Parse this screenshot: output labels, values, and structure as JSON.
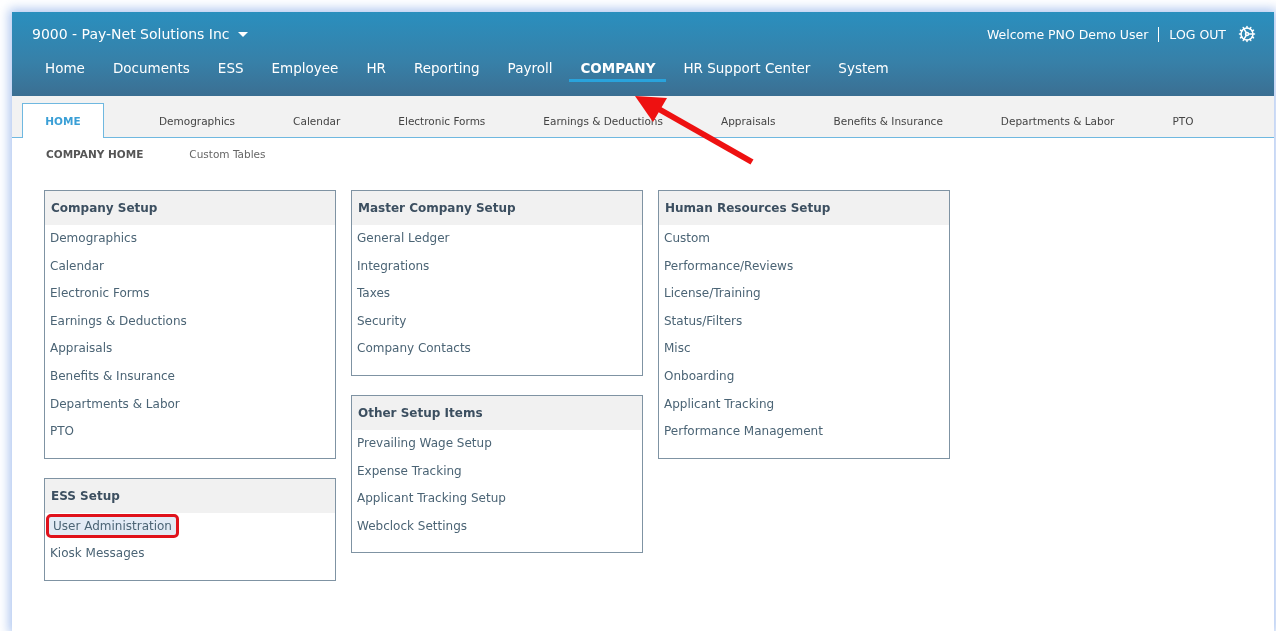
{
  "header": {
    "company": "9000 - Pay-Net Solutions Inc",
    "welcome": "Welcome PNO Demo User",
    "logout": "LOG OUT"
  },
  "nav": [
    {
      "label": "Home",
      "selected": false
    },
    {
      "label": "Documents",
      "selected": false
    },
    {
      "label": "ESS",
      "selected": false
    },
    {
      "label": "Employee",
      "selected": false
    },
    {
      "label": "HR",
      "selected": false
    },
    {
      "label": "Reporting",
      "selected": false
    },
    {
      "label": "Payroll",
      "selected": false
    },
    {
      "label": "COMPANY",
      "selected": true
    },
    {
      "label": "HR Support Center",
      "selected": false
    },
    {
      "label": "System",
      "selected": false
    }
  ],
  "tabs": [
    {
      "label": "HOME",
      "selected": true
    },
    {
      "label": "Demographics",
      "selected": false
    },
    {
      "label": "Calendar",
      "selected": false
    },
    {
      "label": "Electronic Forms",
      "selected": false
    },
    {
      "label": "Earnings & Deductions",
      "selected": false
    },
    {
      "label": "Appraisals",
      "selected": false
    },
    {
      "label": "Benefits & Insurance",
      "selected": false
    },
    {
      "label": "Departments & Labor",
      "selected": false
    },
    {
      "label": "PTO",
      "selected": false
    }
  ],
  "subnav": [
    {
      "label": "COMPANY HOME",
      "selected": true
    },
    {
      "label": "Custom Tables",
      "selected": false
    }
  ],
  "columns": [
    [
      {
        "title": "Company Setup",
        "items": [
          {
            "label": "Demographics",
            "highlighted": false
          },
          {
            "label": "Calendar",
            "highlighted": false
          },
          {
            "label": "Electronic Forms",
            "highlighted": false
          },
          {
            "label": "Earnings & Deductions",
            "highlighted": false
          },
          {
            "label": "Appraisals",
            "highlighted": false
          },
          {
            "label": "Benefits & Insurance",
            "highlighted": false
          },
          {
            "label": "Departments & Labor",
            "highlighted": false
          },
          {
            "label": "PTO",
            "highlighted": false
          }
        ]
      },
      {
        "title": "ESS Setup",
        "items": [
          {
            "label": "User Administration",
            "highlighted": true
          },
          {
            "label": "Kiosk Messages",
            "highlighted": false
          }
        ]
      }
    ],
    [
      {
        "title": "Master Company Setup",
        "items": [
          {
            "label": "General Ledger",
            "highlighted": false
          },
          {
            "label": "Integrations",
            "highlighted": false
          },
          {
            "label": "Taxes",
            "highlighted": false
          },
          {
            "label": "Security",
            "highlighted": false
          },
          {
            "label": "Company Contacts",
            "highlighted": false
          }
        ]
      },
      {
        "title": "Other Setup Items",
        "items": [
          {
            "label": "Prevailing Wage Setup",
            "highlighted": false
          },
          {
            "label": "Expense Tracking",
            "highlighted": false
          },
          {
            "label": "Applicant Tracking Setup",
            "highlighted": false
          },
          {
            "label": "Webclock Settings",
            "highlighted": false
          }
        ]
      }
    ],
    [
      {
        "title": "Human Resources Setup",
        "items": [
          {
            "label": "Custom",
            "highlighted": false
          },
          {
            "label": "Performance/Reviews",
            "highlighted": false
          },
          {
            "label": "License/Training",
            "highlighted": false
          },
          {
            "label": "Status/Filters",
            "highlighted": false
          },
          {
            "label": "Misc",
            "highlighted": false
          },
          {
            "label": "Onboarding",
            "highlighted": false
          },
          {
            "label": "Applicant Tracking",
            "highlighted": false
          },
          {
            "label": "Performance Management",
            "highlighted": false
          }
        ]
      }
    ]
  ]
}
